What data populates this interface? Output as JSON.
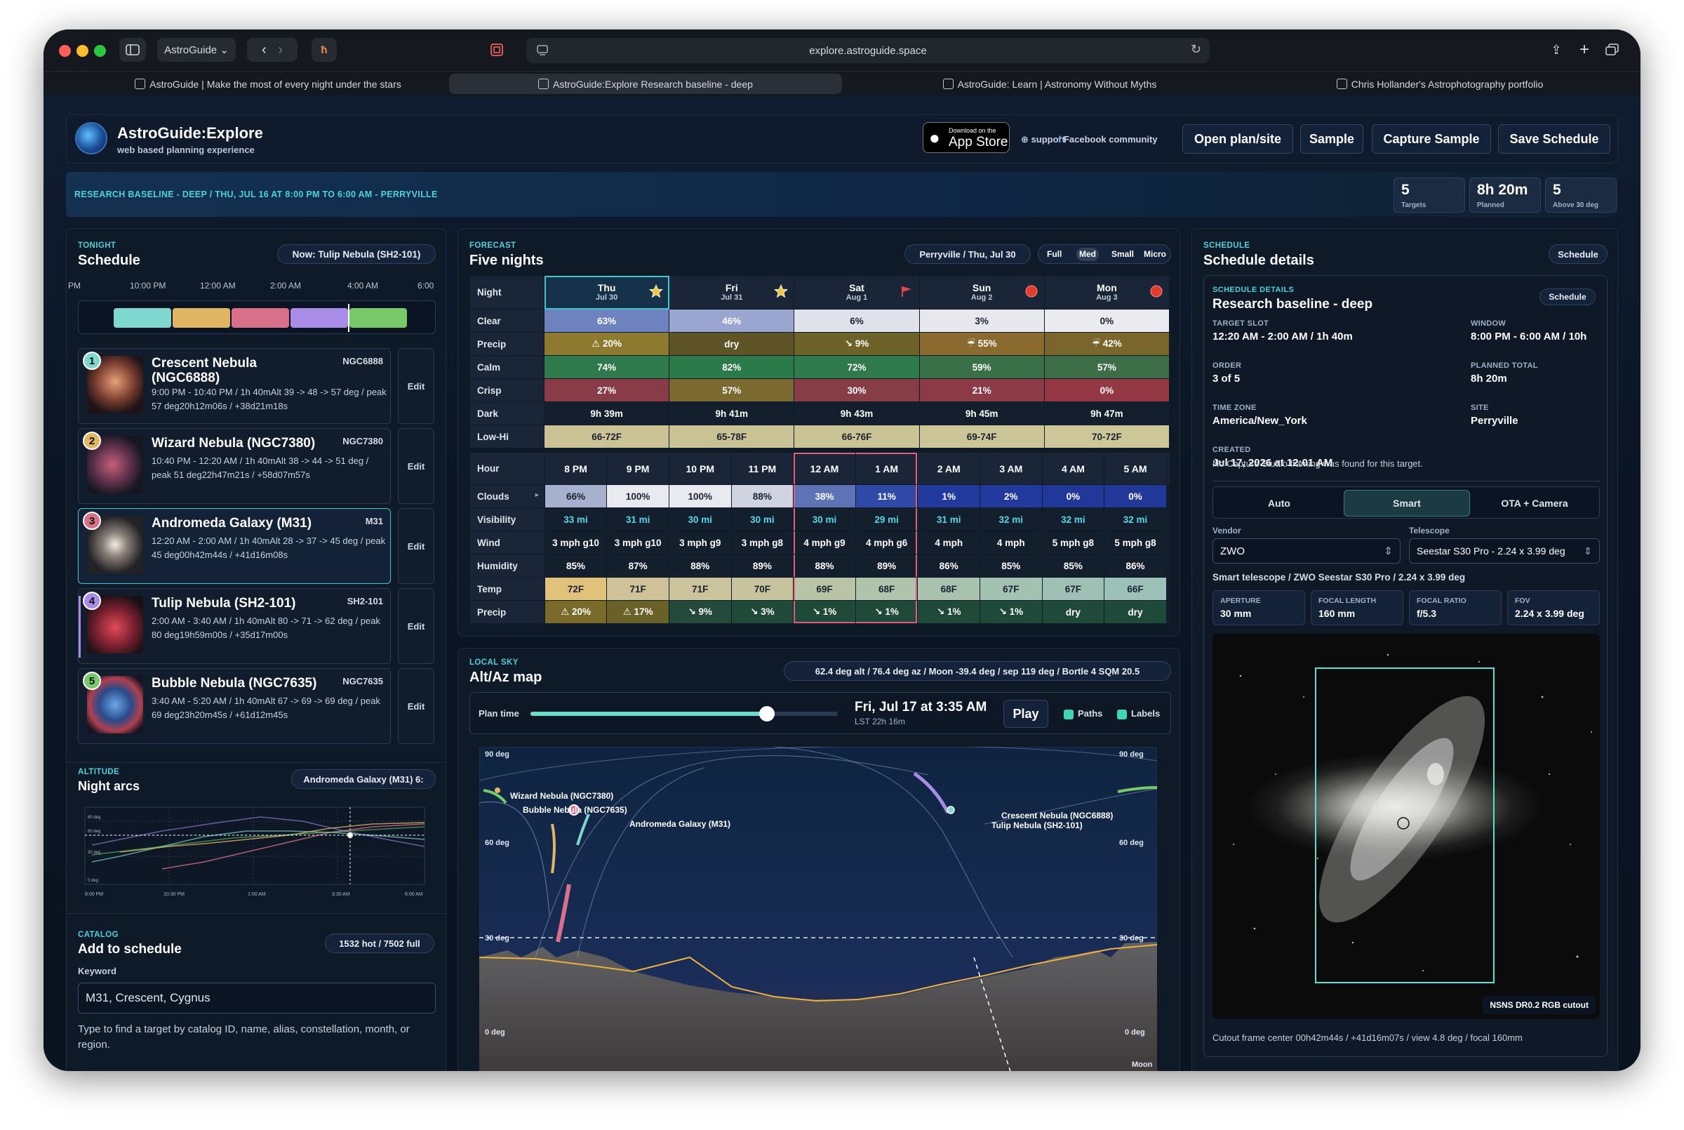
{
  "browser": {
    "app_label": "AstroGuide",
    "url": "explore.astroguide.space",
    "tabs": [
      "AstroGuide | Make the most of every night under the stars",
      "AstroGuide:Explore Research baseline - deep",
      "AstroGuide: Learn | Astronomy Without Myths",
      "Chris Hollander's Astrophotography portfolio"
    ]
  },
  "header": {
    "title": "AstroGuide:Explore",
    "subtitle": "web based planning experience",
    "appstore_small": "Download on the",
    "appstore_big": "App Store",
    "support": "support",
    "facebook": "Facebook community",
    "buttons": {
      "open": "Open plan/site",
      "sample": "Sample",
      "capture": "Capture Sample",
      "save": "Save Schedule"
    }
  },
  "banner": {
    "text": "RESEARCH BASELINE - DEEP / THU, JUL 16 AT 8:00 PM TO 6:00 AM - PERRYVILLE",
    "stats": [
      {
        "value": "5",
        "label": "Targets"
      },
      {
        "value": "8h 20m",
        "label": "Planned"
      },
      {
        "value": "5",
        "label": "Above 30 deg"
      }
    ]
  },
  "tonight": {
    "eyebrow": "TONIGHT",
    "title": "Schedule",
    "now": "Now: Tulip Nebula (SH2-101)",
    "times": [
      "PM",
      "10:00 PM",
      "12:00 AM",
      "2:00 AM",
      "4:00 AM",
      "6:00"
    ],
    "bar_colors": [
      "#7fd8cf",
      "#e0b665",
      "#d9708a",
      "#a88ce8",
      "#77c96a"
    ],
    "edit_label": "Edit",
    "targets": [
      {
        "n": "1",
        "name": "Crescent Nebula (NGC6888)",
        "catalog": "NGC6888",
        "detail": "9:00 PM - 10:40 PM / 1h 40mAlt 39 -> 48 -> 57 deg / peak 57 deg20h12m06s / +38d21m18s",
        "color": "#7fd8cf"
      },
      {
        "n": "2",
        "name": "Wizard Nebula (NGC7380)",
        "catalog": "NGC7380",
        "detail": "10:40 PM - 12:20 AM / 1h 40mAlt 38 -> 44 -> 51 deg / peak 51 deg22h47m21s / +58d07m57s",
        "color": "#e0b665"
      },
      {
        "n": "3",
        "name": "Andromeda Galaxy (M31)",
        "catalog": "M31",
        "detail": "12:20 AM - 2:00 AM / 1h 40mAlt 28 -> 37 -> 45 deg / peak 45 deg00h42m44s / +41d16m08s",
        "color": "#d9708a"
      },
      {
        "n": "4",
        "name": "Tulip Nebula (SH2-101)",
        "catalog": "SH2-101",
        "detail": "2:00 AM - 3:40 AM / 1h 40mAlt 80 -> 71 -> 62 deg / peak 80 deg19h59m00s / +35d17m00s",
        "color": "#a88ce8"
      },
      {
        "n": "5",
        "name": "Bubble Nebula (NGC7635)",
        "catalog": "NGC7635",
        "detail": "3:40 AM - 5:20 AM / 1h 40mAlt 67 -> 69 -> 69 deg / peak 69 deg23h20m45s / +61d12m45s",
        "color": "#77c96a"
      }
    ]
  },
  "altitude": {
    "eyebrow": "ALTITUDE",
    "title": "Night arcs",
    "target": "Andromeda Galaxy (M31) 6:",
    "ylabels": [
      "80 deg",
      "60 deg",
      "30 deg",
      "0 deg"
    ],
    "xlabels": [
      "8:00 PM",
      "10:30 PM",
      "1:00 AM",
      "3:30 AM",
      "6:00 AM"
    ]
  },
  "catalog": {
    "eyebrow": "CATALOG",
    "title": "Add to schedule",
    "count": "1532 hot / 7502 full",
    "keyword_label": "Keyword",
    "keyword_value": "M31, Crescent, Cygnus",
    "help": "Type to find a target by catalog ID, name, alias, constellation, month, or region."
  },
  "forecast": {
    "eyebrow": "FORECAST",
    "title": "Five nights",
    "location": "Perryville / Thu, Jul 30",
    "sizes": [
      "Full",
      "Med",
      "Small",
      "Micro"
    ],
    "active_size": "Med",
    "nights": [
      {
        "day": "Thu",
        "date": "Jul 30",
        "icon": "star"
      },
      {
        "day": "Fri",
        "date": "Jul 31",
        "icon": "star"
      },
      {
        "day": "Sat",
        "date": "Aug 1",
        "icon": "flag"
      },
      {
        "day": "Sun",
        "date": "Aug 2",
        "icon": "red"
      },
      {
        "day": "Mon",
        "date": "Aug 3",
        "icon": "red"
      }
    ],
    "night_label": "Night",
    "rows": [
      {
        "label": "Clear",
        "cells": [
          "63%",
          "46%",
          "6%",
          "3%",
          "0%"
        ],
        "colors": [
          "#6e82bf",
          "#9aa6cf",
          "#dfe2ea",
          "#e6e8ee",
          "#e9ebf0"
        ],
        "dark": [
          false,
          false,
          true,
          true,
          true
        ]
      },
      {
        "label": "Precip",
        "cells": [
          "⚠ 20%",
          "dry",
          "↘ 9%",
          "☔ 55%",
          "☔ 42%"
        ],
        "colors": [
          "#8e7a2e",
          "#5e5427",
          "#6d6228",
          "#8a6a2e",
          "#7a662d"
        ],
        "dark": [
          false,
          false,
          false,
          false,
          false
        ]
      },
      {
        "label": "Calm",
        "cells": [
          "74%",
          "82%",
          "72%",
          "59%",
          "57%"
        ],
        "colors": [
          "#2f7a4c",
          "#2b7a4a",
          "#2f7a4c",
          "#3a7048",
          "#3d6d47"
        ],
        "dark": [
          false,
          false,
          false,
          false,
          false
        ]
      },
      {
        "label": "Crisp",
        "cells": [
          "27%",
          "57%",
          "30%",
          "21%",
          "0%"
        ],
        "colors": [
          "#8a3b48",
          "#7a6a30",
          "#873d46",
          "#8c3a46",
          "#943943"
        ],
        "dark": [
          false,
          false,
          false,
          false,
          false
        ]
      },
      {
        "label": "Dark",
        "cells": [
          "9h 39m",
          "9h 41m",
          "9h 43m",
          "9h 45m",
          "9h 47m"
        ],
        "colors": [
          "#141f2e",
          "#141f2e",
          "#141f2e",
          "#141f2e",
          "#141f2e"
        ],
        "dark": [
          false,
          false,
          false,
          false,
          false
        ]
      },
      {
        "label": "Low-Hi",
        "cells": [
          "66-72F",
          "65-78F",
          "66-76F",
          "69-74F",
          "70-72F"
        ],
        "colors": [
          "#cbc396",
          "#c8c294",
          "#cac395",
          "#ccc597",
          "#ccc698"
        ],
        "dark": [
          true,
          true,
          true,
          true,
          true
        ]
      }
    ],
    "hour_label": "Hour",
    "hours": [
      "8 PM",
      "9 PM",
      "10 PM",
      "11 PM",
      "12 AM",
      "1 AM",
      "2 AM",
      "3 AM",
      "4 AM",
      "5 AM"
    ],
    "hourly": [
      {
        "label": "Clouds",
        "cells": [
          "66%",
          "100%",
          "100%",
          "88%",
          "38%",
          "11%",
          "1%",
          "2%",
          "0%",
          "0%"
        ],
        "colors": [
          "#a7b0cc",
          "#e8eaef",
          "#e8eaef",
          "#cfd4e0",
          "#5d73b6",
          "#2f4aa6",
          "#22399e",
          "#22399e",
          "#213898",
          "#213898"
        ],
        "dark": [
          true,
          true,
          true,
          true,
          false,
          false,
          false,
          false,
          false,
          false
        ]
      },
      {
        "label": "Visibility",
        "cells": [
          "33 mi",
          "31 mi",
          "30 mi",
          "30 mi",
          "30 mi",
          "29 mi",
          "31 mi",
          "32 mi",
          "32 mi",
          "32 mi"
        ],
        "colors": [
          "#141f2e",
          "#141f2e",
          "#141f2e",
          "#141f2e",
          "#141f2e",
          "#141f2e",
          "#141f2e",
          "#141f2e",
          "#141f2e",
          "#141f2e"
        ],
        "dark": [
          false,
          false,
          false,
          false,
          false,
          false,
          false,
          false,
          false,
          false
        ],
        "accent": "#56d7e6"
      },
      {
        "label": "Wind",
        "cells": [
          "3 mph g10",
          "3 mph g10",
          "3 mph g9",
          "3 mph g8",
          "4 mph g9",
          "4 mph g6",
          "4 mph",
          "4 mph",
          "5 mph g8",
          "5 mph g8"
        ],
        "colors": [
          "#141f2e",
          "#141f2e",
          "#141f2e",
          "#141f2e",
          "#141f2e",
          "#141f2e",
          "#141f2e",
          "#141f2e",
          "#141f2e",
          "#141f2e"
        ],
        "dark": [
          false,
          false,
          false,
          false,
          false,
          false,
          false,
          false,
          false,
          false
        ]
      },
      {
        "label": "Humidity",
        "cells": [
          "85%",
          "87%",
          "88%",
          "89%",
          "88%",
          "89%",
          "86%",
          "85%",
          "85%",
          "86%"
        ],
        "colors": [
          "#141f2e",
          "#141f2e",
          "#141f2e",
          "#141f2e",
          "#141f2e",
          "#141f2e",
          "#141f2e",
          "#141f2e",
          "#141f2e",
          "#141f2e"
        ],
        "dark": [
          false,
          false,
          false,
          false,
          false,
          false,
          false,
          false,
          false,
          false
        ]
      },
      {
        "label": "Temp",
        "cells": [
          "72F",
          "71F",
          "71F",
          "70F",
          "69F",
          "68F",
          "68F",
          "67F",
          "67F",
          "66F"
        ],
        "colors": [
          "#e0c27b",
          "#cfc298",
          "#cbc39b",
          "#c7c39d",
          "#b9c3a6",
          "#b0c3ab",
          "#a9c2ae",
          "#a4c2b2",
          "#9fc1b5",
          "#9bc1b8"
        ],
        "dark": [
          true,
          true,
          true,
          true,
          true,
          true,
          true,
          true,
          true,
          true
        ]
      },
      {
        "label": "Precip",
        "cells": [
          "⚠ 20%",
          "⚠ 17%",
          "↘ 9%",
          "↘ 3%",
          "↘ 1%",
          "↘ 1%",
          "↘ 1%",
          "↘ 1%",
          "dry",
          "dry"
        ],
        "colors": [
          "#7b6b2a",
          "#6a6129",
          "#234a3a",
          "#1f4a3a",
          "#1f4a3a",
          "#1f4a3a",
          "#1f4a3a",
          "#1f4a3a",
          "#1f4a3a",
          "#1f4a3a"
        ],
        "dark": [
          false,
          false,
          false,
          false,
          false,
          false,
          false,
          false,
          false,
          false
        ]
      }
    ]
  },
  "localsky": {
    "eyebrow": "LOCAL SKY",
    "title": "Alt/Az map",
    "readout": "62.4 deg alt / 76.4 deg az / Moon -39.4 deg / sep 119 deg / Bortle 4 SQM 20.5",
    "plan_time_label": "Plan time",
    "plan_time_fraction": 0.77,
    "datetime": "Fri, Jul 17 at 3:35 AM",
    "lst": "LST 22h 16m",
    "play": "Play",
    "paths": "Paths",
    "labels": "Labels",
    "deg_labels": [
      "90 deg",
      "60 deg",
      "30 deg",
      "0 deg"
    ],
    "targets": [
      "Wizard Nebula (NGC7380)",
      "Bubble Nebula (NGC7635)",
      "Andromeda Galaxy (M31)",
      "Crescent Nebula (NGC6888)",
      "Tulip Nebula (SH2-101)"
    ],
    "moon": "Moon"
  },
  "details": {
    "eyebrow": "SCHEDULE",
    "title": "Schedule details",
    "btn": "Schedule",
    "inner_eyebrow": "SCHEDULE DETAILS",
    "inner_title": "Research baseline - deep",
    "inner_btn": "Schedule",
    "fields": [
      {
        "k": "TARGET SLOT",
        "v": "12:20 AM - 2:00 AM / 1h 40m"
      },
      {
        "k": "WINDOW",
        "v": "8:00 PM - 6:00 AM / 10h"
      },
      {
        "k": "ORDER",
        "v": "3 of 5"
      },
      {
        "k": "PLANNED TOTAL",
        "v": "8h 20m"
      },
      {
        "k": "TIME ZONE",
        "v": "America/New_York"
      },
      {
        "k": "SITE",
        "v": "Perryville"
      },
      {
        "k": "CREATED",
        "v": "Jul 17, 2026 at 12:01 AM"
      }
    ],
    "note": "No Capture Studio framing was found for this target.",
    "modes": [
      "Auto",
      "Smart",
      "OTA + Camera"
    ],
    "active_mode": "Smart",
    "vendor_label": "Vendor",
    "vendor": "ZWO",
    "telescope_label": "Telescope",
    "telescope": "Seestar S30 Pro - 2.24 x 3.99 deg",
    "scope_line": "Smart telescope / ZWO Seestar S30 Pro / 2.24 x 3.99 deg",
    "specs": [
      {
        "k": "APERTURE",
        "v": "30 mm"
      },
      {
        "k": "FOCAL LENGTH",
        "v": "160 mm"
      },
      {
        "k": "FOCAL RATIO",
        "v": "f/5.3"
      },
      {
        "k": "FOV",
        "v": "2.24 x 3.99 deg"
      }
    ],
    "image_tag": "NSNS DR0.2 RGB cutout",
    "caption": "Cutout frame center 00h42m44s / +41d16m07s / view 4.8 deg / focal 160mm"
  }
}
